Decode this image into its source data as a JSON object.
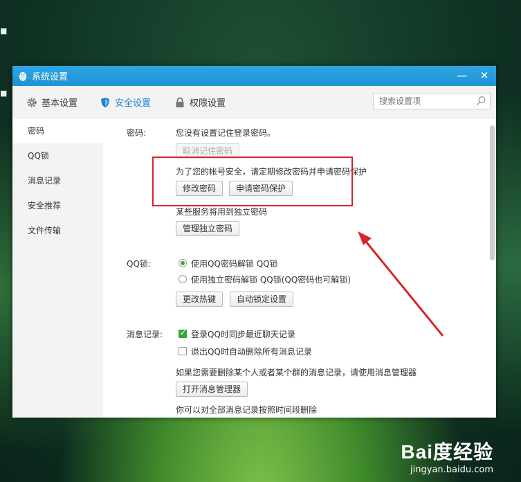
{
  "window": {
    "title": "系统设置",
    "minimize_icon": "minimize-icon",
    "close_icon": "close-icon"
  },
  "toolbar": {
    "tabs": [
      {
        "label": "基本设置",
        "icon": "gear-icon"
      },
      {
        "label": "安全设置",
        "icon": "shield-icon",
        "active": true
      },
      {
        "label": "权限设置",
        "icon": "lock-icon"
      }
    ],
    "search_placeholder": "搜索设置项"
  },
  "sidebar": {
    "items": [
      {
        "label": "密码",
        "active": true
      },
      {
        "label": "QQ锁"
      },
      {
        "label": "消息记录"
      },
      {
        "label": "安全推荐"
      },
      {
        "label": "文件传输"
      }
    ]
  },
  "password": {
    "label": "密码:",
    "status": "您没有设置记住登录密码。",
    "cancel_remember": "取消记住密码",
    "advice": "为了您的帐号安全，请定期修改密码并申请密码保护",
    "change_btn": "修改密码",
    "protect_btn": "申请密码保护",
    "independent_note": "某些服务将用到独立密码",
    "manage_independent_btn": "管理独立密码"
  },
  "qqlock": {
    "label": "QQ锁:",
    "option1": "使用QQ密码解锁 QQ锁",
    "option1_selected": true,
    "option2": "使用独立密码解锁 QQ锁(QQ密码也可解锁)",
    "hotkey_btn": "更改热键",
    "autolock_btn": "自动锁定设置"
  },
  "msglog": {
    "label": "消息记录:",
    "sync_option": "登录QQ时同步最近聊天记录",
    "sync_checked": true,
    "delete_option": "退出QQ时自动删除所有消息记录",
    "delete_checked": false,
    "manager_note": "如果您需要删除某个人或者某个群的消息记录，请使用消息管理器",
    "open_manager_btn": "打开消息管理器",
    "time_delete_note": "你可以对全部消息记录按照时间段删除"
  },
  "colors": {
    "title_bar": "#1f93d4",
    "active_tab": "#1b86d6",
    "annotation": "#d8242a",
    "check_green": "#3aa33a"
  },
  "watermark": {
    "logo": "Bai度经验",
    "url": "jingyan.baidu.com"
  }
}
